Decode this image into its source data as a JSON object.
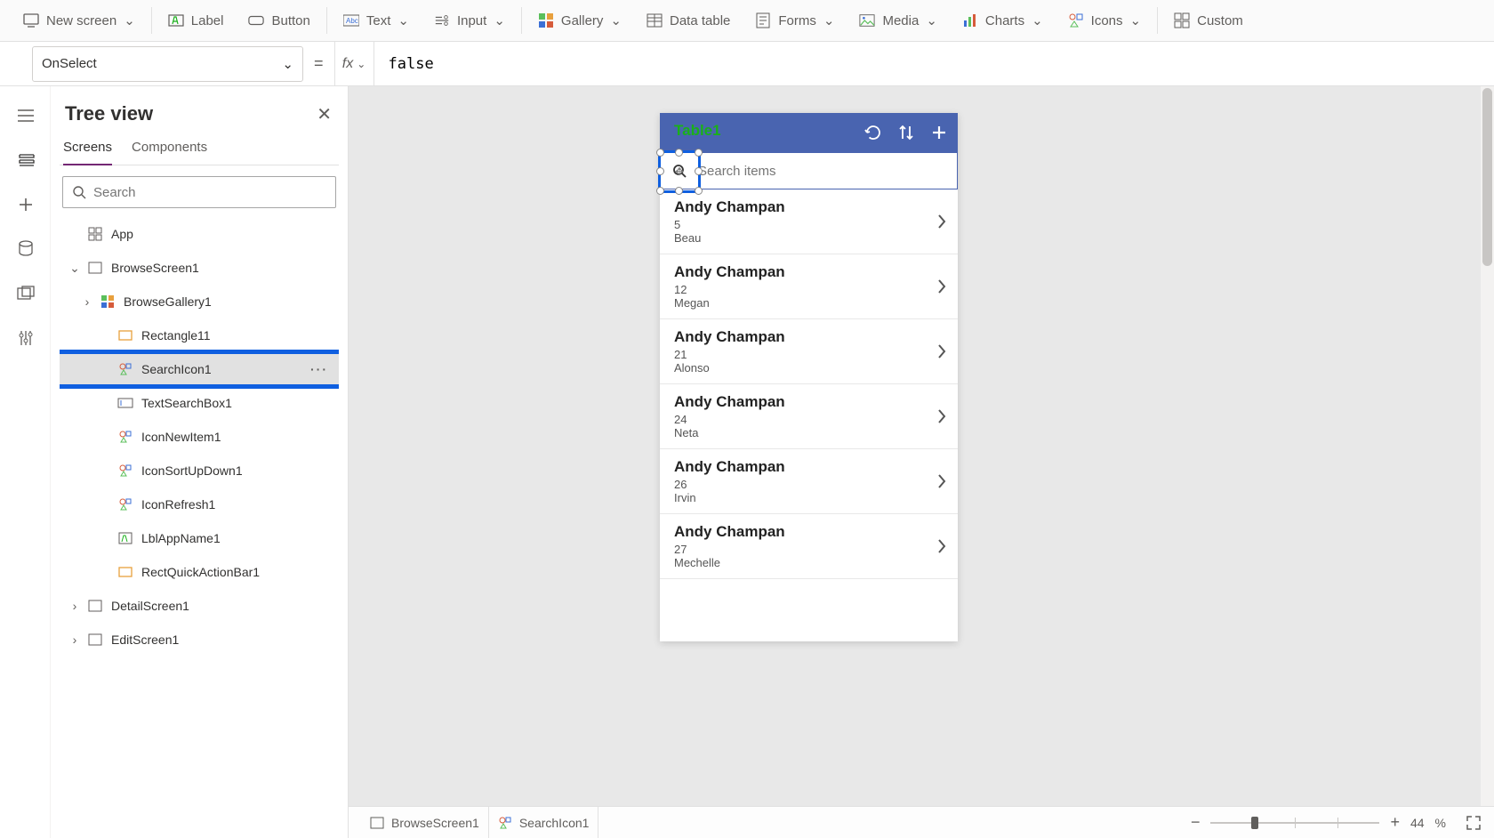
{
  "ribbon": {
    "new_screen": "New screen",
    "label": "Label",
    "button": "Button",
    "text": "Text",
    "input": "Input",
    "gallery": "Gallery",
    "data_table": "Data table",
    "forms": "Forms",
    "media": "Media",
    "charts": "Charts",
    "icons": "Icons",
    "custom": "Custom"
  },
  "formula": {
    "property": "OnSelect",
    "fx": "fx",
    "value": "false"
  },
  "treeview": {
    "title": "Tree view",
    "tabs": {
      "screens": "Screens",
      "components": "Components"
    },
    "search_placeholder": "Search",
    "nodes": {
      "app": "App",
      "browse_screen": "BrowseScreen1",
      "browse_gallery": "BrowseGallery1",
      "rectangle11": "Rectangle11",
      "search_icon": "SearchIcon1",
      "text_search": "TextSearchBox1",
      "icon_new": "IconNewItem1",
      "icon_sort": "IconSortUpDown1",
      "icon_refresh": "IconRefresh1",
      "lbl_app": "LblAppName1",
      "rect_quick": "RectQuickActionBar1",
      "detail_screen": "DetailScreen1",
      "edit_screen": "EditScreen1"
    }
  },
  "canvas": {
    "app_title": "Table1",
    "search_placeholder": "Search items",
    "items": [
      {
        "title": "Andy Champan",
        "sub1": "5",
        "sub2": "Beau"
      },
      {
        "title": "Andy Champan",
        "sub1": "12",
        "sub2": "Megan"
      },
      {
        "title": "Andy Champan",
        "sub1": "21",
        "sub2": "Alonso"
      },
      {
        "title": "Andy Champan",
        "sub1": "24",
        "sub2": "Neta"
      },
      {
        "title": "Andy Champan",
        "sub1": "26",
        "sub2": "Irvin"
      },
      {
        "title": "Andy Champan",
        "sub1": "27",
        "sub2": "Mechelle"
      }
    ]
  },
  "status": {
    "crumb1": "BrowseScreen1",
    "crumb2": "SearchIcon1",
    "zoom_pct": "44",
    "zoom_suffix": "%"
  }
}
